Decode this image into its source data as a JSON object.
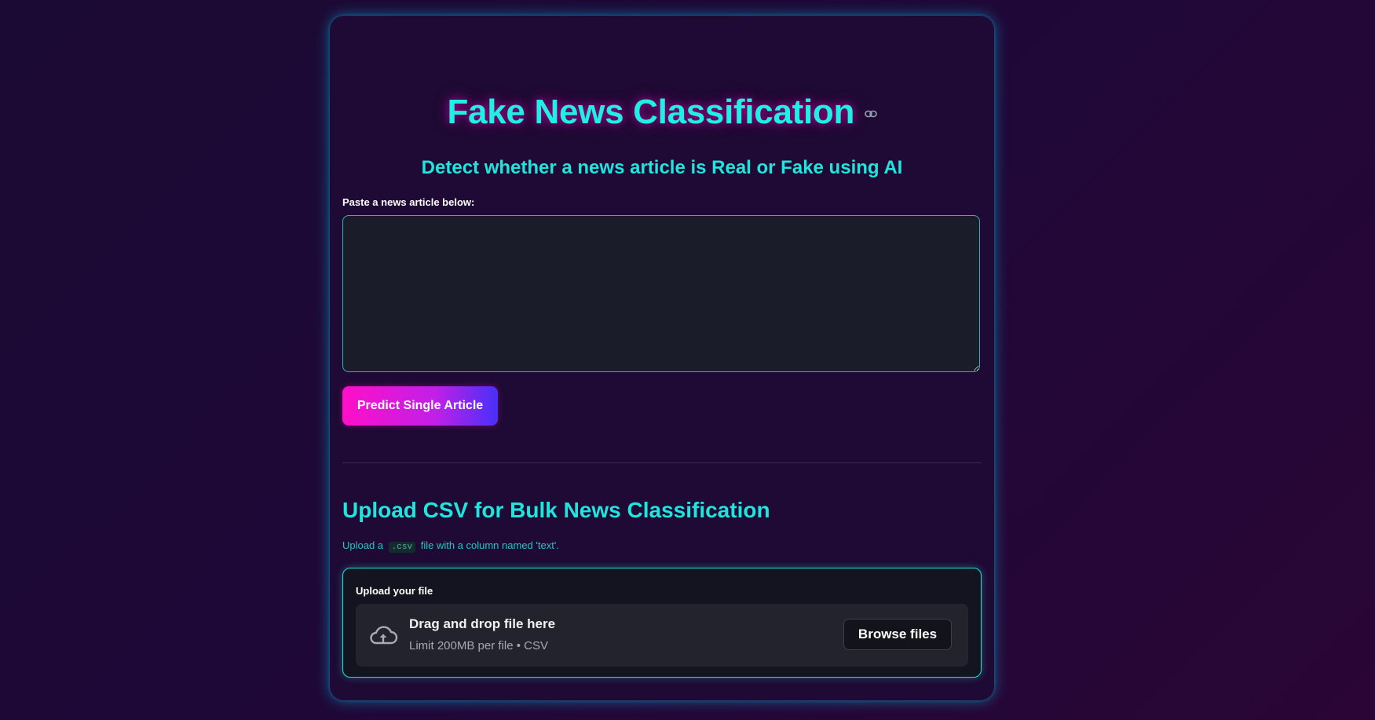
{
  "header": {
    "title": "Fake News Classification",
    "subtitle": "Detect whether a news article is Real or Fake using AI"
  },
  "single": {
    "label": "Paste a news article below:",
    "textarea_value": "",
    "button_label": "Predict Single Article"
  },
  "bulk": {
    "heading": "Upload CSV for Bulk News Classification",
    "caption_prefix": "Upload a",
    "caption_code": ".csv",
    "caption_suffix": "file with a column named 'text'.",
    "uploader": {
      "label": "Upload your file",
      "drop_title": "Drag and drop file here",
      "drop_limit": "Limit 200MB per file • CSV",
      "browse_label": "Browse files"
    }
  },
  "colors": {
    "accent_cyan": "#1ef0e4",
    "button_gradient_start": "#ff0fc8",
    "button_gradient_end": "#4830f8",
    "card_background": "#1e0a34"
  },
  "icons": {
    "title_anchor": "link-icon",
    "uploader": "cloud-upload-icon"
  }
}
